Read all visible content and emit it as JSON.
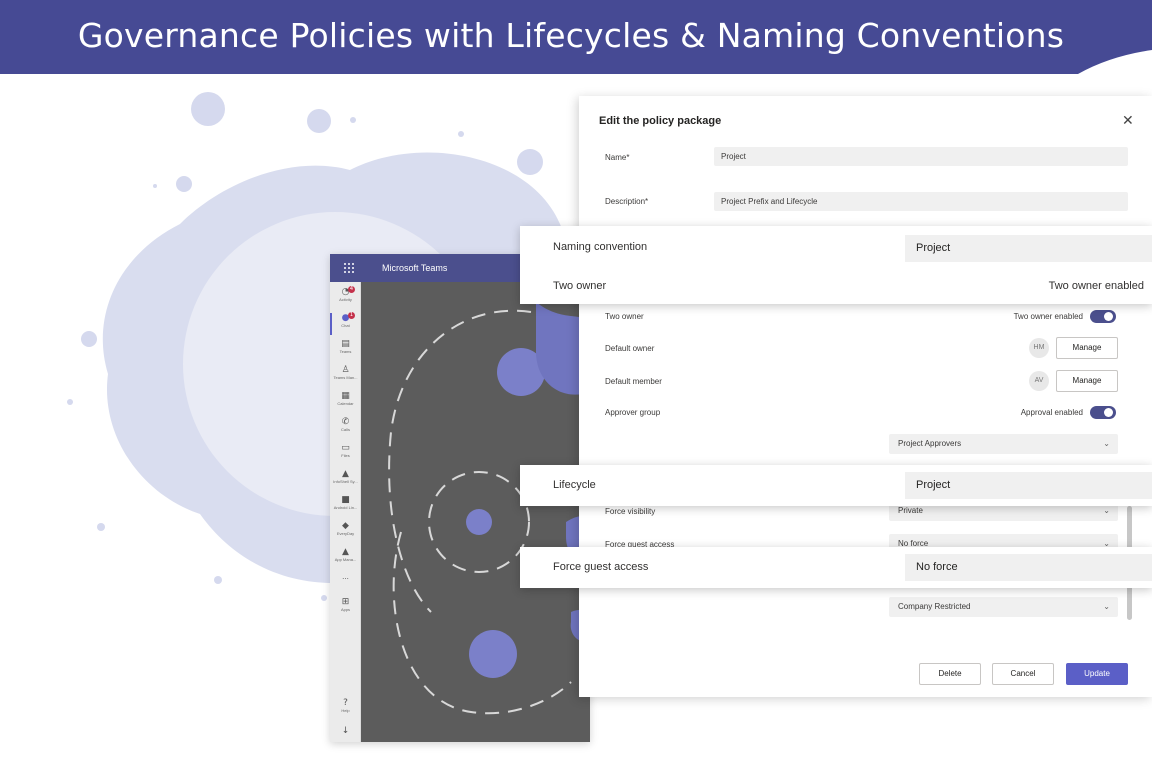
{
  "banner": {
    "title": "Governance Policies with Lifecycles & Naming Conventions",
    "color": "#464a94"
  },
  "teams": {
    "title": "Microsoft Teams",
    "header_color": "#4b4f8d",
    "rail": [
      {
        "label": "Activity",
        "icon": "bell-icon",
        "badge": "4"
      },
      {
        "label": "Chat",
        "icon": "chat-icon",
        "badge": "1"
      },
      {
        "label": "Teams",
        "icon": "teams-icon",
        "badge": ""
      },
      {
        "label": "Teams Man...",
        "icon": "teams-manager-icon",
        "badge": ""
      },
      {
        "label": "Calendar",
        "icon": "calendar-icon",
        "badge": ""
      },
      {
        "label": "Calls",
        "icon": "phone-icon",
        "badge": ""
      },
      {
        "label": "Files",
        "icon": "file-icon",
        "badge": ""
      },
      {
        "label": "InfoShell Sy...",
        "icon": "app-icon",
        "badge": ""
      },
      {
        "label": "Android Lin...",
        "icon": "app-icon",
        "badge": ""
      },
      {
        "label": "EveryDay",
        "icon": "app-icon",
        "badge": ""
      },
      {
        "label": "App Mana...",
        "icon": "app-icon",
        "badge": ""
      }
    ],
    "more": "...",
    "apps_label": "Apps",
    "help_label": "Help"
  },
  "dialog": {
    "title": "Edit the policy package",
    "close": "✕",
    "name_label": "Name*",
    "name_value": "Project",
    "description_label": "Description*",
    "description_value": "Project Prefix and Lifecycle",
    "two_owner_label": "Two owner",
    "two_owner_toggle": "Two owner enabled",
    "default_owner_label": "Default owner",
    "default_owner_avatar": "HM",
    "default_member_label": "Default member",
    "default_member_avatar": "AV",
    "manage_label": "Manage",
    "approver_group_label": "Approver group",
    "approval_toggle": "Approval enabled",
    "approver_dropdown": "Project Approvers",
    "force_visibility_label": "Force visibility",
    "force_visibility_value": "Private",
    "force_guest_label": "Force guest access",
    "force_guest_value": "No force",
    "sensitivity_value": "Company Restricted",
    "delete_label": "Delete",
    "cancel_label": "Cancel",
    "update_label": "Update",
    "accent": "#5b5fc7"
  },
  "callouts": {
    "naming_label": "Naming convention",
    "naming_value": "Project",
    "two_owner_label": "Two owner",
    "two_owner_value": "Two owner enabled",
    "lifecycle_label": "Lifecycle",
    "lifecycle_value": "Project",
    "guest_label": "Force guest access",
    "guest_value": "No force"
  }
}
